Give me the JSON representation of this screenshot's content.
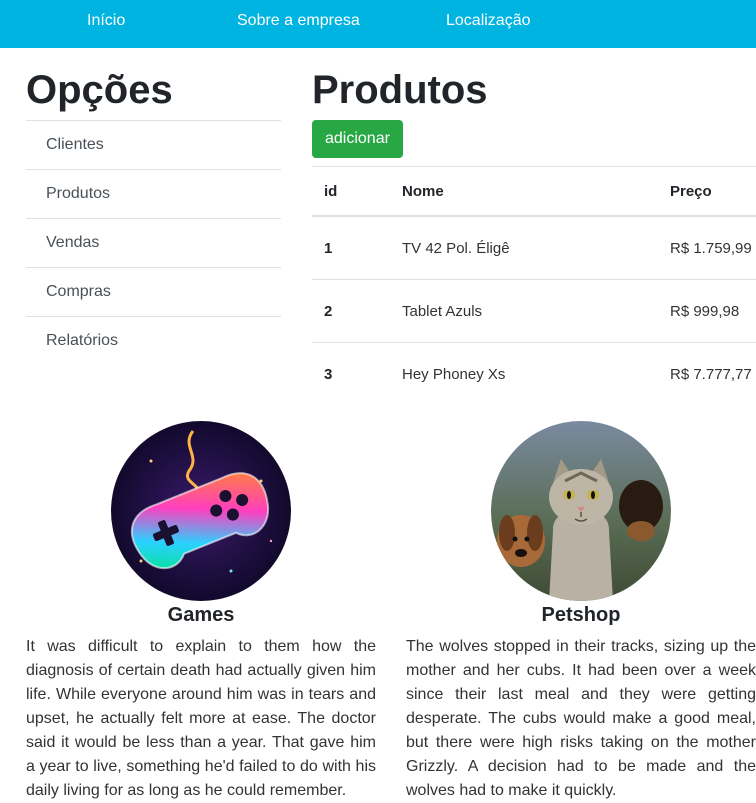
{
  "nav": {
    "items": [
      "Início",
      "Sobre a empresa",
      "Localização"
    ]
  },
  "sidebar": {
    "title": "Opções",
    "items": [
      "Clientes",
      "Produtos",
      "Vendas",
      "Compras",
      "Relatórios"
    ]
  },
  "main": {
    "title": "Produtos",
    "add_button": "adicionar",
    "table": {
      "headers": [
        "id",
        "Nome",
        "Preço"
      ],
      "rows": [
        [
          "1",
          "TV 42 Pol. Éligê",
          "R$ 1.759,99"
        ],
        [
          "2",
          "Tablet Azuls",
          "R$ 999,98"
        ],
        [
          "3",
          "Hey Phoney Xs",
          "R$ 7.777,77"
        ]
      ]
    }
  },
  "cards": [
    {
      "title": "Games",
      "icon": "gamepad-image",
      "text": "It was difficult to explain to them how the diagnosis of certain death had actually given him life. While everyone around him was in tears and upset, he actually felt more at ease. The doctor said it would be less than a year. That gave him a year to live, something he'd failed to do with his daily living for as long as he could remember."
    },
    {
      "title": "Petshop",
      "icon": "pets-image",
      "text": "The wolves stopped in their tracks, sizing up the mother and her cubs. It had been over a week since their last meal and they were getting desperate. The cubs would make a good meal, but there were high risks taking on the mother Grizzly. A decision had to be made and the wolves had to make it quickly."
    }
  ],
  "colors": {
    "nav_bg": "#00b4e1",
    "button_bg": "#28a745",
    "border": "#dee2e6"
  }
}
